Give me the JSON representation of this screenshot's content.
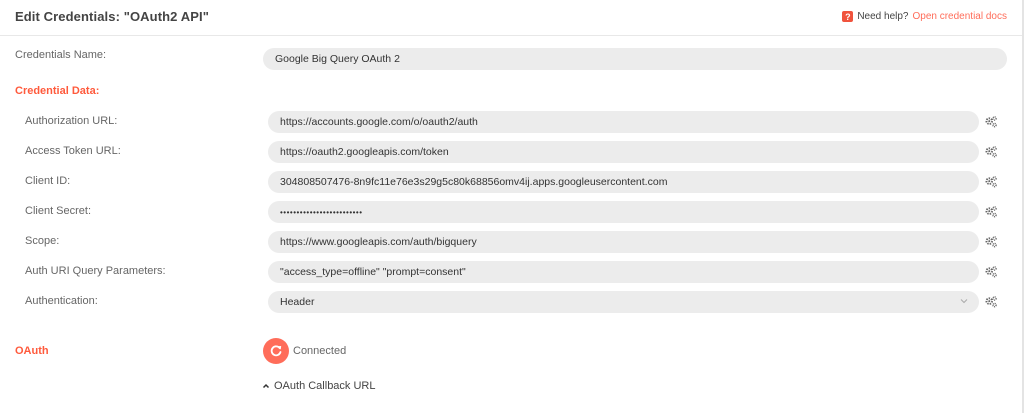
{
  "title": "Edit Credentials: \"OAuth2 API\"",
  "help": {
    "prefix": "Need help?",
    "link": "Open credential docs",
    "icon": "question-mark-icon"
  },
  "credentials_name": {
    "label": "Credentials Name:",
    "value": "Google Big Query OAuth 2"
  },
  "credential_data_label": "Credential Data:",
  "fields": [
    {
      "label": "Authorization URL:",
      "value": "https://accounts.google.com/o/oauth2/auth"
    },
    {
      "label": "Access Token URL:",
      "value": "https://oauth2.googleapis.com/token"
    },
    {
      "label": "Client ID:",
      "value": "304808507476-8n9fc11e76e3s29g5c80k68856omv4ij.apps.googleusercontent.com"
    },
    {
      "label": "Client Secret:",
      "value": "•••••••••••••••••••••••••"
    },
    {
      "label": "Scope:",
      "value": "https://www.googleapis.com/auth/bigquery"
    },
    {
      "label": "Auth URI Query Parameters:",
      "value": "\"access_type=offline\" \"prompt=consent\""
    },
    {
      "label": "Authentication:",
      "value": "Header"
    }
  ],
  "oauth": {
    "label": "OAuth",
    "status": "Connected",
    "callback_label": "OAuth Callback URL"
  },
  "colors": {
    "accent": "#ff6d5a",
    "section": "#ff5a3c",
    "field_bg": "#ececec"
  }
}
